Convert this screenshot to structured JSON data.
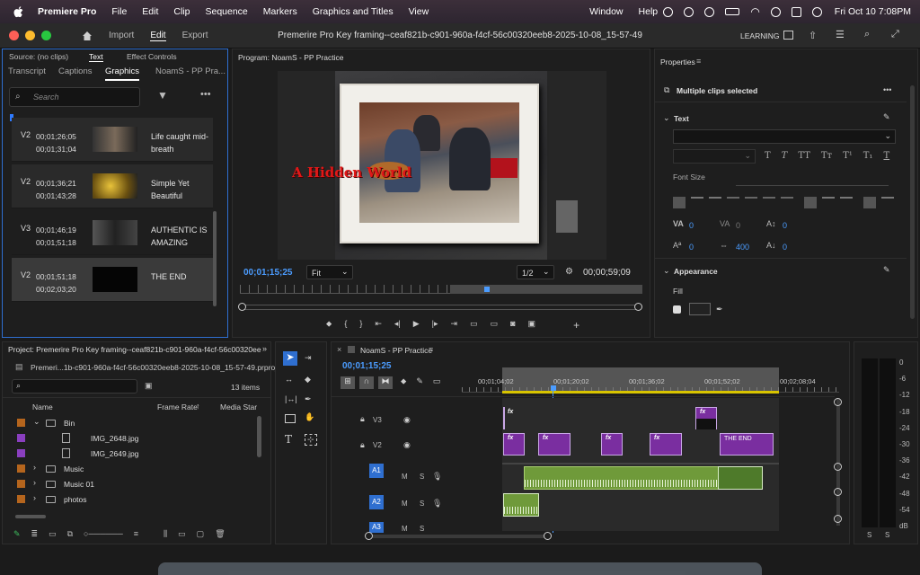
{
  "menubar": {
    "items": [
      "Premiere Pro",
      "File",
      "Edit",
      "Clip",
      "Sequence",
      "Markers",
      "Graphics and Titles",
      "View",
      "Window",
      "Help"
    ],
    "clock": "Fri Oct 10  7:08PM"
  },
  "titlebar": {
    "workspaces": [
      "Import",
      "Edit",
      "Export"
    ],
    "active_workspace": "Edit",
    "document_title": "Premerire Pro Key framing--ceaf821b-c901-960a-f4cf-56c00320eeb8-2025-10-08_15-57-49",
    "layout_label": "LEARNING"
  },
  "left_panel": {
    "top_tabs": [
      "Source: (no clips)",
      "Text",
      "Effect Controls"
    ],
    "tabs": [
      "Transcript",
      "Captions",
      "Graphics",
      "NoamS - PP Pra..."
    ],
    "active_tab": "Graphics",
    "search_placeholder": "Search",
    "cards": [
      {
        "track": "V2",
        "tc_in": "00;01;26;05",
        "tc_out": "00;01;31;04",
        "name": "Life caught mid-breath"
      },
      {
        "track": "V2",
        "tc_in": "00;01;36;21",
        "tc_out": "00;01;43;28",
        "name": "Simple Yet Beautiful"
      },
      {
        "track": "V3",
        "tc_in": "00;01;46;19",
        "tc_out": "00;01;51;18",
        "name": "AUTHENTIC IS AMAZING"
      },
      {
        "track": "V2",
        "tc_in": "00;01;51;18",
        "tc_out": "00;02;03;20",
        "name": "THE END"
      }
    ]
  },
  "program": {
    "title": "Program: NoamS - PP Practice",
    "overlay_text": "A Hidden World",
    "timecode": "00;01;15;25",
    "fit": "Fit",
    "resolution": "1/2",
    "duration": "00;00;59;09"
  },
  "properties": {
    "title": "Properties",
    "selection": "Multiple clips selected",
    "text_section": "Text",
    "font_size_label": "Font Size",
    "values": {
      "tracking": "0",
      "kerning": "0",
      "baseline": "0",
      "leading": "0",
      "tsume": "400",
      "caps": "0"
    },
    "appearance": "Appearance",
    "fill": "Fill"
  },
  "project": {
    "title": "Project: Premerire Pro Key framing--ceaf821b-c901-960a-f4cf-56c00320eeb8-2025",
    "file": "Premeri...1b-c901-960a-f4cf-56c00320eeb8-2025-10-08_15-57-49.prproj",
    "count": "13 items",
    "columns": [
      "Name",
      "Frame Rate",
      "Media Star"
    ],
    "rows": [
      {
        "name": "Bin",
        "type": "folder",
        "open": true,
        "color": "#b5651d",
        "indent": 0
      },
      {
        "name": "IMG_2648.jpg",
        "type": "file",
        "color": "#8a3fbf",
        "indent": 1
      },
      {
        "name": "IMG_2649.jpg",
        "type": "file",
        "color": "#8a3fbf",
        "indent": 1
      },
      {
        "name": "Music",
        "type": "folder",
        "open": false,
        "color": "#b5651d",
        "indent": 0
      },
      {
        "name": "Music 01",
        "type": "folder",
        "open": false,
        "color": "#b5651d",
        "indent": 0
      },
      {
        "name": "photos",
        "type": "folder",
        "open": false,
        "color": "#b5651d",
        "indent": 0
      }
    ]
  },
  "timeline": {
    "tab": "NoamS - PP Practice",
    "timecode": "00;01;15;25",
    "ruler": [
      "00;01;04;02",
      "00;01;20;02",
      "00;01;36;02",
      "00;01;52;02",
      "00;02;08;04"
    ],
    "tracks": [
      "V3",
      "V2",
      "A1",
      "A2",
      "A3"
    ],
    "the_end_label": "THE END"
  },
  "meter": {
    "scale": [
      "0",
      "-6",
      "-12",
      "-18",
      "-24",
      "-30",
      "-36",
      "-42",
      "-48",
      "-54",
      "dB"
    ],
    "solo": [
      "S",
      "S"
    ]
  }
}
